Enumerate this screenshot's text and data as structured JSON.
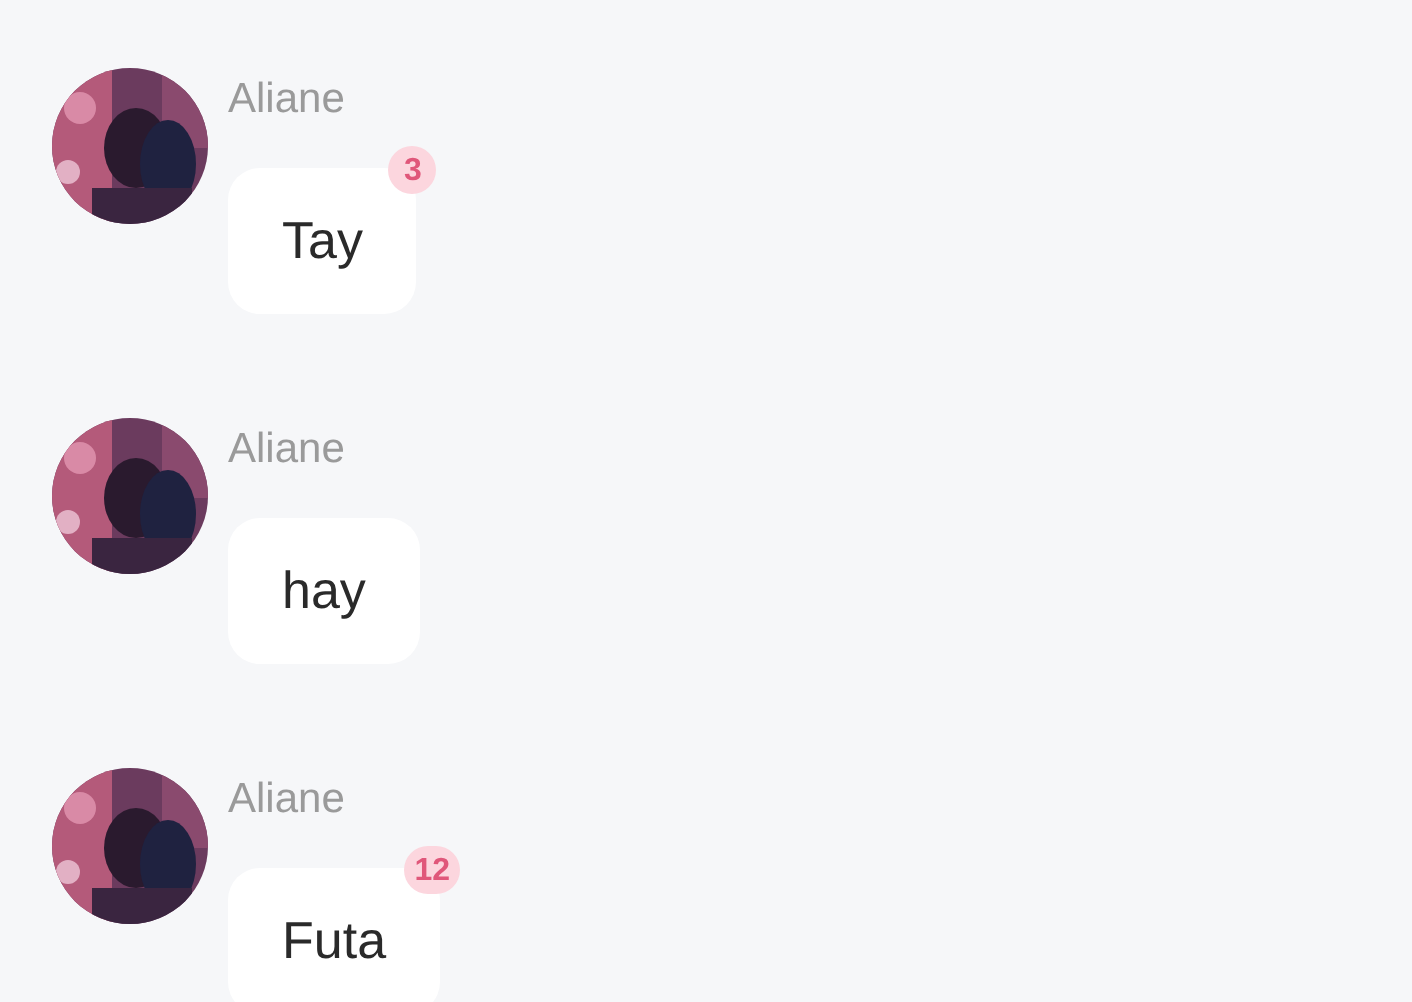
{
  "messages": [
    {
      "sender": "Aliane",
      "text": "Tay",
      "badge": "3"
    },
    {
      "sender": "Aliane",
      "text": "hay"
    },
    {
      "sender": "Aliane",
      "text": "Futa",
      "badge": "12"
    }
  ]
}
